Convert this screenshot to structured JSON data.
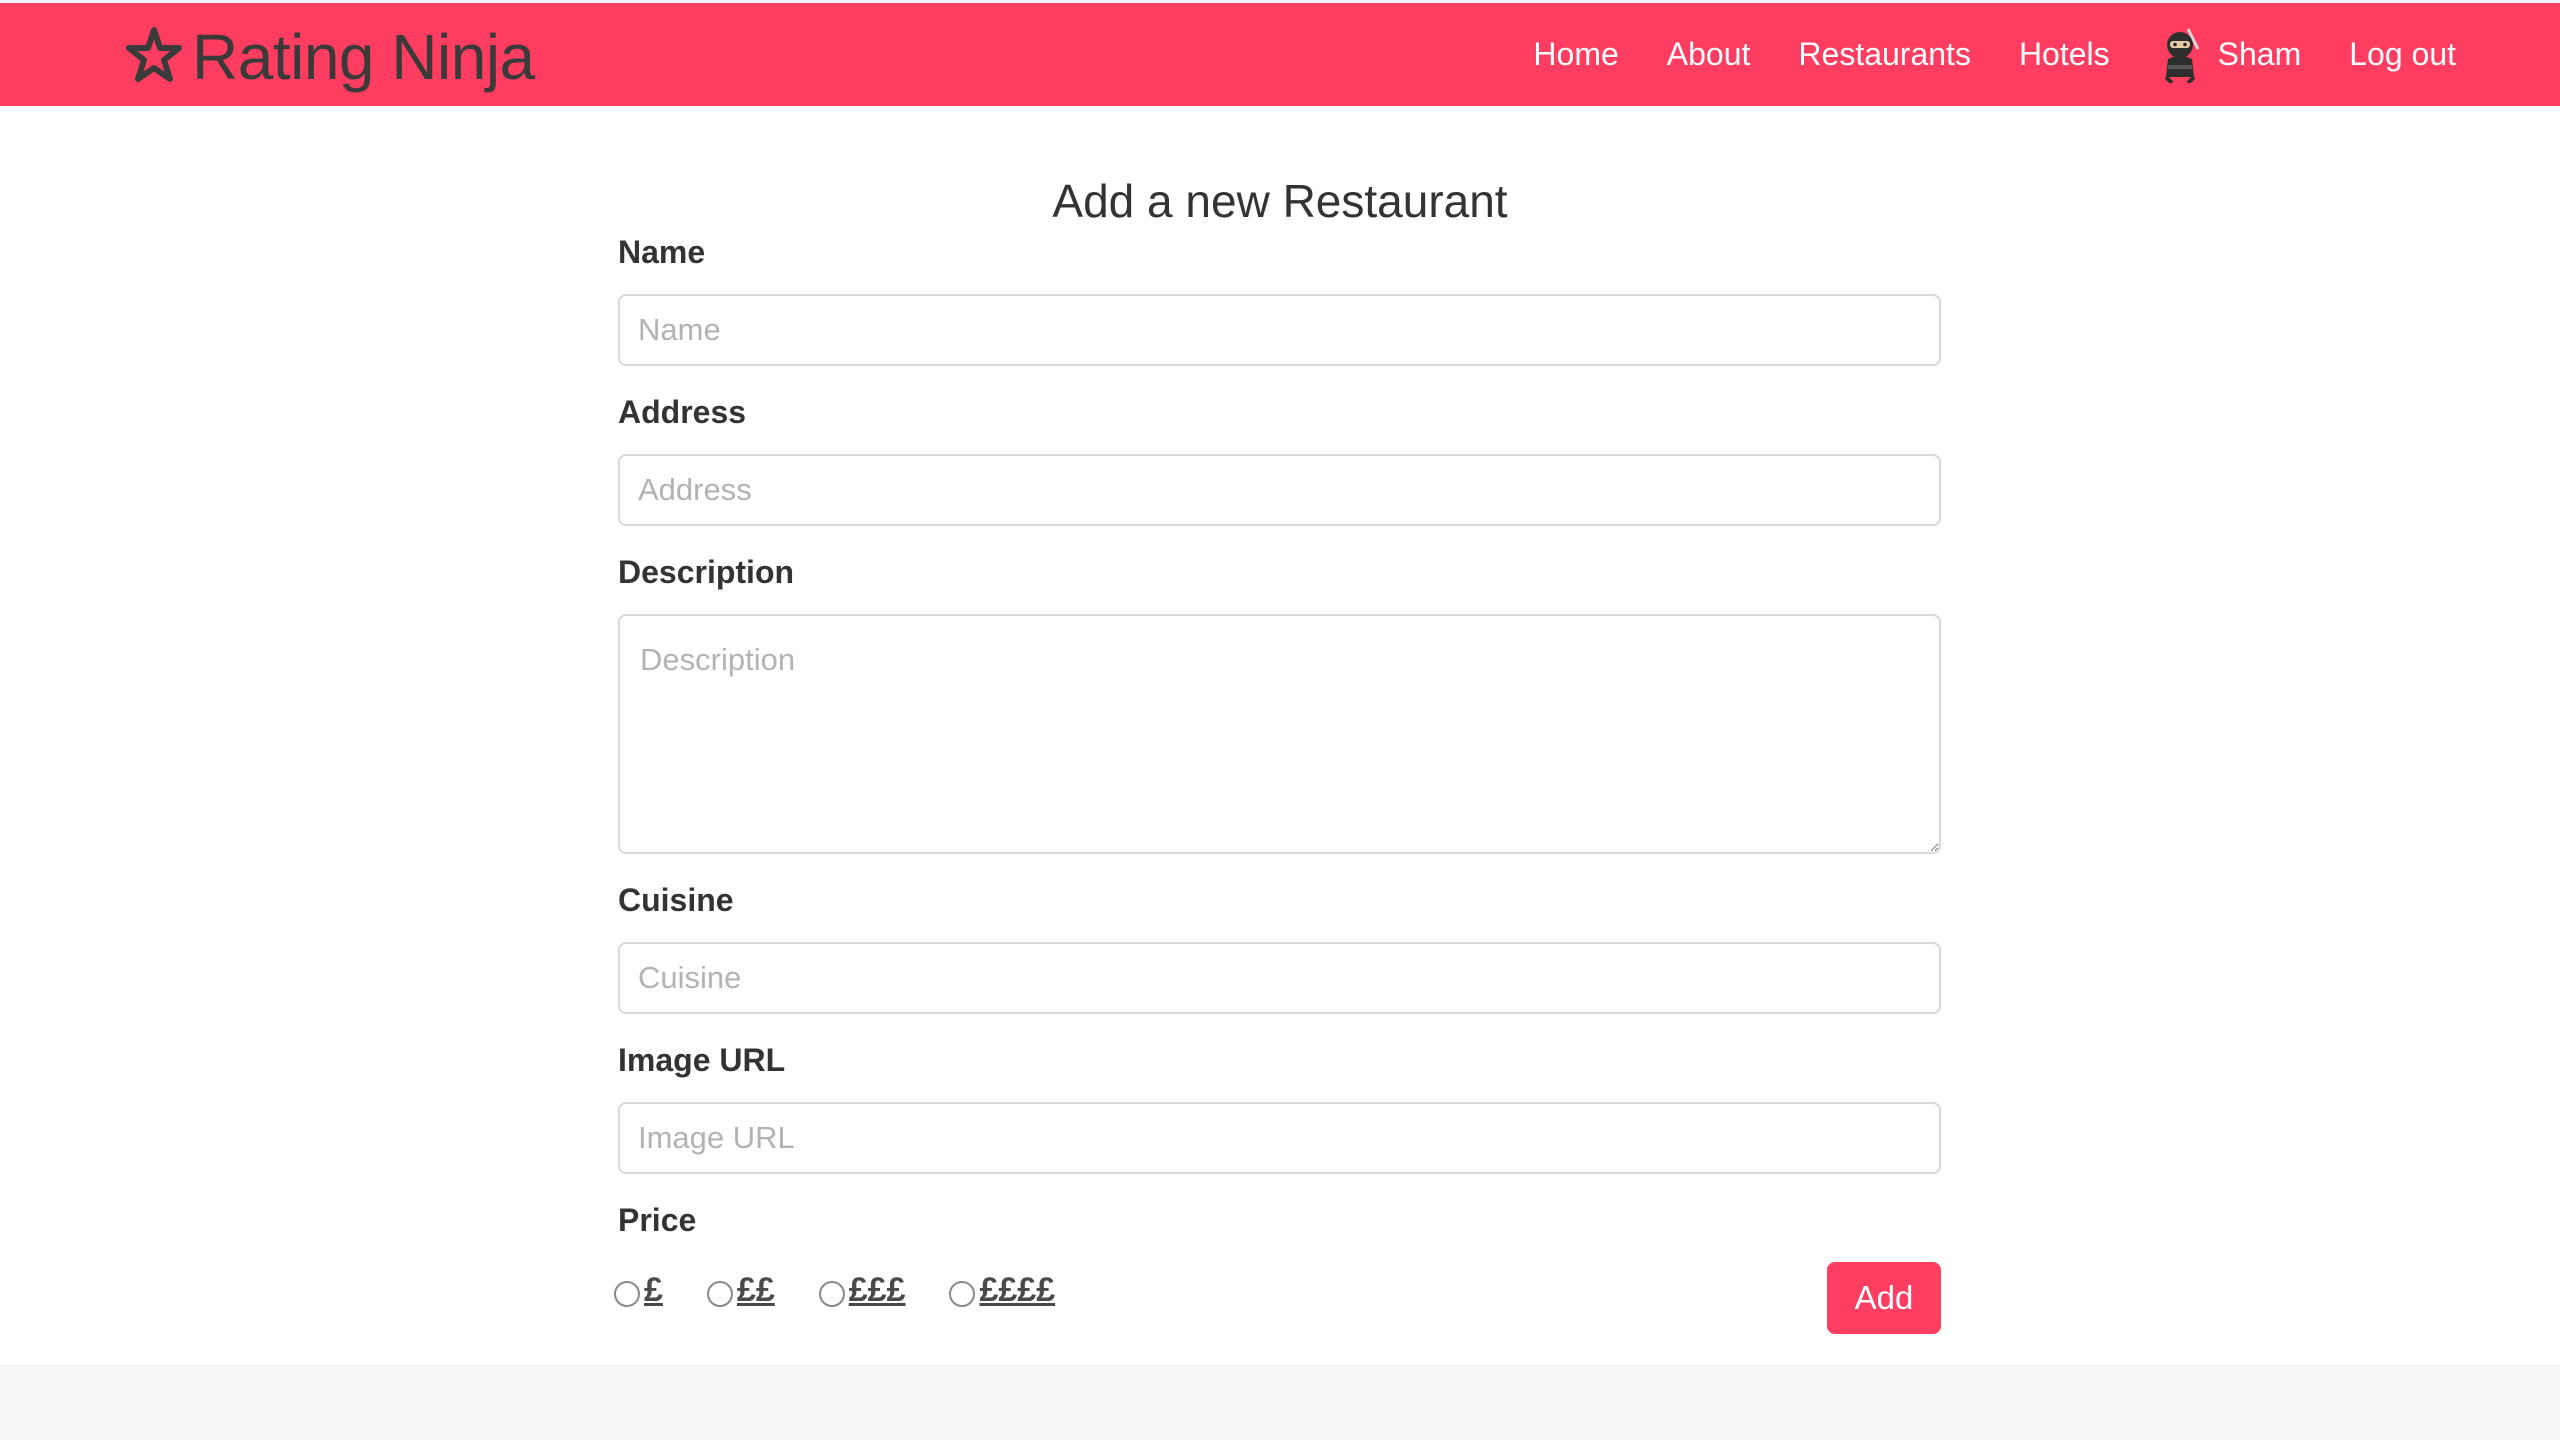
{
  "navbar": {
    "brand": "Rating Ninja",
    "brand_icon": "star-icon",
    "links": [
      {
        "label": "Home"
      },
      {
        "label": "About"
      },
      {
        "label": "Restaurants"
      },
      {
        "label": "Hotels"
      },
      {
        "label": "Sham",
        "icon": "ninja-avatar-icon"
      },
      {
        "label": "Log out"
      }
    ],
    "background_color": "#ff3d60"
  },
  "form": {
    "title": "Add a new Restaurant",
    "fields": {
      "name": {
        "label": "Name",
        "placeholder": "Name",
        "value": ""
      },
      "address": {
        "label": "Address",
        "placeholder": "Address",
        "value": ""
      },
      "description": {
        "label": "Description",
        "placeholder": "Description",
        "value": ""
      },
      "cuisine": {
        "label": "Cuisine",
        "placeholder": "Cuisine",
        "value": ""
      },
      "image_url": {
        "label": "Image URL",
        "placeholder": "Image URL",
        "value": ""
      }
    },
    "price": {
      "label": "Price",
      "options": [
        "£",
        "££",
        "£££",
        "££££"
      ],
      "selected": null
    },
    "submit_label": "Add",
    "accent_color": "#ff3d60"
  }
}
